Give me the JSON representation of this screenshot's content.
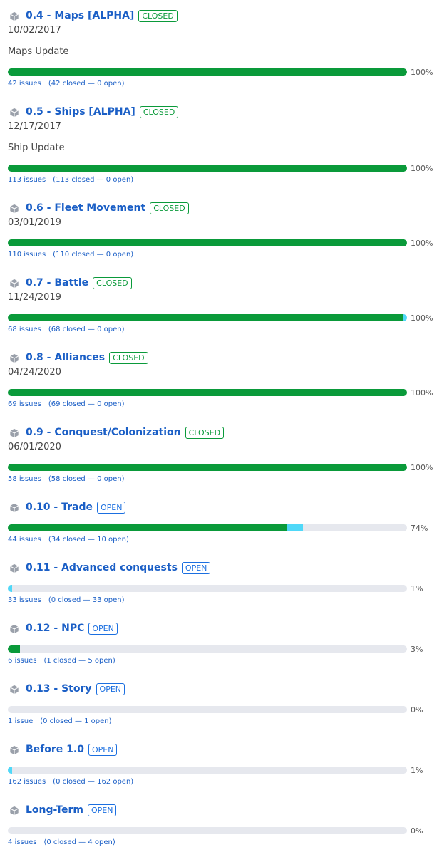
{
  "colors": {
    "closed": "#0a9a3a",
    "in_progress": "#4fd8f8",
    "track": "#e6e8ee",
    "link": "#1b5fc6"
  },
  "milestones": [
    {
      "icon": "package-icon",
      "title": "0.4 - Maps [ALPHA]",
      "state": "CLOSED",
      "date": "10/02/2017",
      "description": "Maps Update",
      "closed_pct": 100,
      "progress_pct": 0,
      "percent": "100%",
      "issues": "42 issues",
      "detail": "(42 closed — 0 open)"
    },
    {
      "icon": "package-icon",
      "title": "0.5 - Ships [ALPHA]",
      "state": "CLOSED",
      "date": "12/17/2017",
      "description": "Ship Update",
      "closed_pct": 100,
      "progress_pct": 0,
      "percent": "100%",
      "issues": "113 issues",
      "detail": "(113 closed — 0 open)"
    },
    {
      "icon": "package-icon",
      "title": "0.6 - Fleet Movement",
      "state": "CLOSED",
      "date": "03/01/2019",
      "closed_pct": 100,
      "progress_pct": 0,
      "percent": "100%",
      "issues": "110 issues",
      "detail": "(110 closed — 0 open)"
    },
    {
      "icon": "package-icon",
      "title": "0.7 - Battle",
      "state": "CLOSED",
      "date": "11/24/2019",
      "closed_pct": 99,
      "progress_pct": 1,
      "percent": "100%",
      "issues": "68 issues",
      "detail": "(68 closed — 0 open)"
    },
    {
      "icon": "package-icon",
      "title": "0.8 - Alliances",
      "state": "CLOSED",
      "date": "04/24/2020",
      "closed_pct": 100,
      "progress_pct": 0,
      "percent": "100%",
      "issues": "69 issues",
      "detail": "(69 closed — 0 open)"
    },
    {
      "icon": "package-icon",
      "title": "0.9 - Conquest/Colonization",
      "state": "CLOSED",
      "date": "06/01/2020",
      "closed_pct": 100,
      "progress_pct": 0,
      "percent": "100%",
      "issues": "58 issues",
      "detail": "(58 closed — 0 open)"
    },
    {
      "icon": "package-icon",
      "title": "0.10 - Trade",
      "state": "OPEN",
      "closed_pct": 70,
      "progress_pct": 4,
      "percent": "74%",
      "issues": "44 issues",
      "detail": "(34 closed — 10 open)"
    },
    {
      "icon": "package-icon",
      "title": "0.11 - Advanced conquests",
      "state": "OPEN",
      "closed_pct": 0,
      "progress_pct": 1,
      "percent": "1%",
      "issues": "33 issues",
      "detail": "(0 closed — 33 open)"
    },
    {
      "icon": "package-icon",
      "title": "0.12 - NPC",
      "state": "OPEN",
      "closed_pct": 3,
      "progress_pct": 0,
      "percent": "3%",
      "issues": "6 issues",
      "detail": "(1 closed — 5 open)"
    },
    {
      "icon": "package-icon",
      "title": "0.13 - Story",
      "state": "OPEN",
      "closed_pct": 0,
      "progress_pct": 0,
      "percent": "0%",
      "issues": "1 issue",
      "detail": "(0 closed — 1 open)"
    },
    {
      "icon": "package-icon",
      "title": "Before 1.0",
      "state": "OPEN",
      "closed_pct": 0,
      "progress_pct": 1,
      "percent": "1%",
      "issues": "162 issues",
      "detail": "(0 closed — 162 open)"
    },
    {
      "icon": "package-icon",
      "title": "Long-Term",
      "state": "OPEN",
      "closed_pct": 0,
      "progress_pct": 0,
      "percent": "0%",
      "issues": "4 issues",
      "detail": "(0 closed — 4 open)"
    }
  ]
}
